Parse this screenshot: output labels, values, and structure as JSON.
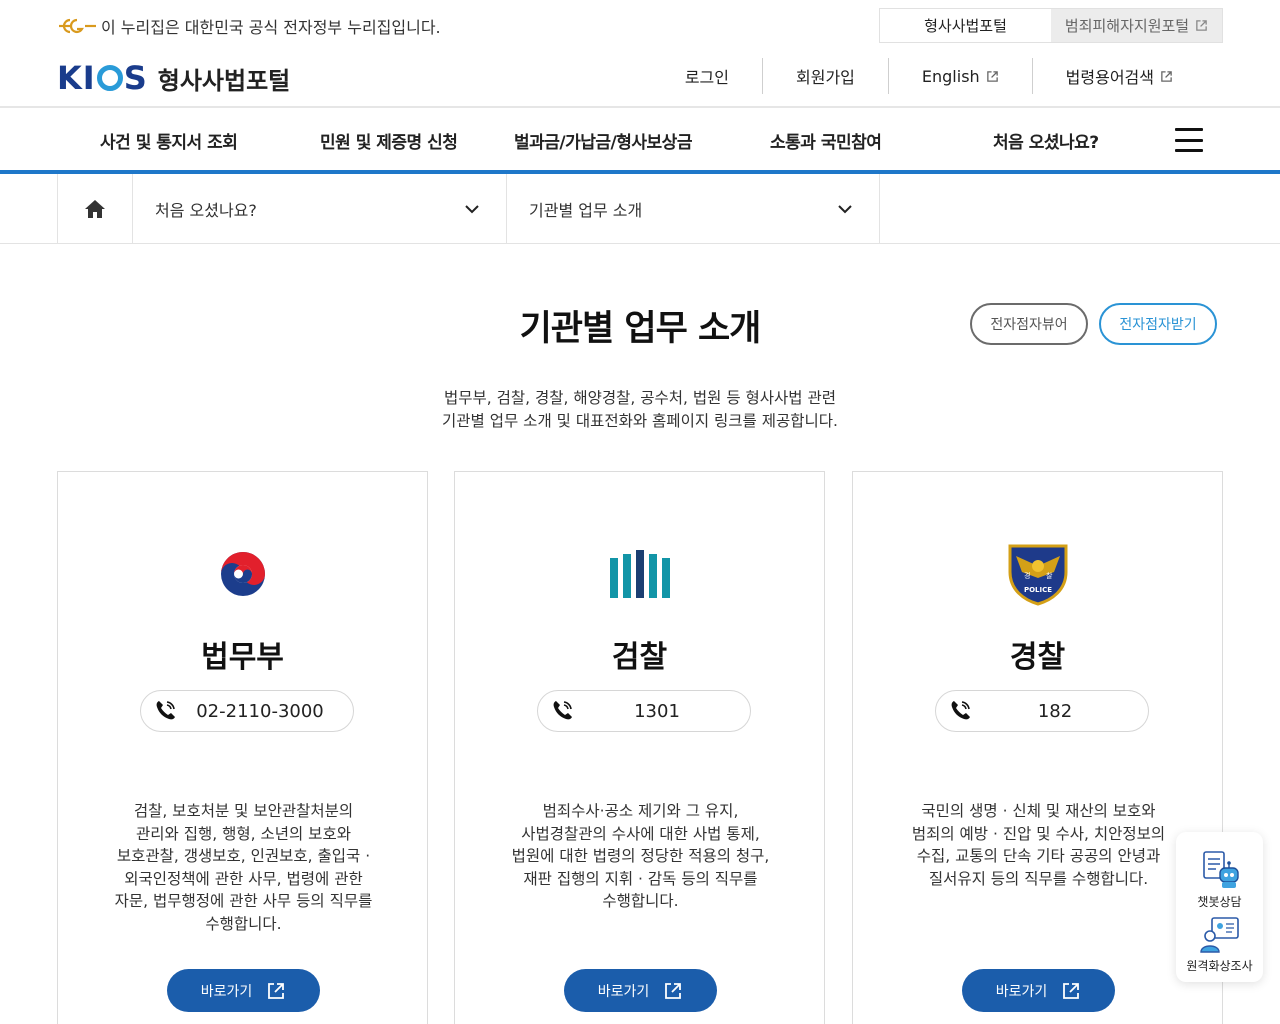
{
  "gov_banner": {
    "text": "이 누리집은 대한민국 공식 전자정부 누리집입니다.",
    "mark_icon": "egov-mark-icon"
  },
  "portal_switch": {
    "tabs": [
      {
        "label": "형사사법포털",
        "active": true
      },
      {
        "label": "범죄피해자지원포털",
        "active": false,
        "external": true
      }
    ]
  },
  "header": {
    "logo_text": "KICS",
    "site_name": "형사사법포털",
    "util_links": [
      {
        "label": "로그인",
        "external": false
      },
      {
        "label": "회원가입",
        "external": false
      },
      {
        "label": "English",
        "external": true
      },
      {
        "label": "법령용어검색",
        "external": true
      }
    ]
  },
  "gnb": {
    "menus": [
      "사건 및 통지서 조회",
      "민원 및 제증명 신청",
      "벌과금/가납금/형사보상금",
      "소통과 국민참여",
      "처음 오셨나요?"
    ],
    "menu_icon": "hamburger-menu-icon"
  },
  "breadcrumb": {
    "home_icon": "home-icon",
    "level1": "처음 오셨나요?",
    "level2": "기관별 업무 소개"
  },
  "page": {
    "title": "기관별 업무 소개",
    "braille_view": "전자점자뷰어",
    "braille_receive": "전자점자받기",
    "intro_line1": "법무부, 검찰, 경찰, 해양경찰, 공수처, 법원 등 형사사법 관련",
    "intro_line2": "기관별 업무 소개 및 대표전화와 홈페이지 링크를 제공합니다."
  },
  "cards": [
    {
      "name": "법무부",
      "phone": "02-2110-3000",
      "emblem_icon": "taegeuk-emblem-icon",
      "desc": [
        "검찰, 보호처분 및 보안관찰처분의",
        "관리와 집행, 행형, 소년의 보호와",
        "보호관찰, 갱생보호, 인권보호, 출입국 ·",
        "외국인정책에 관한 사무, 법령에 관한",
        "자문, 법무행정에 관한 사무 등의 직무를",
        "수행합니다."
      ],
      "button": "바로가기"
    },
    {
      "name": "검찰",
      "phone": "1301",
      "emblem_icon": "prosecution-emblem-icon",
      "desc": [
        "범죄수사·공소 제기와 그 유지,",
        "사법경찰관의 수사에 대한 사법 통제,",
        "법원에 대한 법령의 정당한 적용의 청구,",
        "재판 집행의 지휘 · 감독 등의 직무를",
        "수행합니다."
      ],
      "button": "바로가기"
    },
    {
      "name": "경찰",
      "phone": "182",
      "emblem_icon": "police-emblem-icon",
      "emblem_text": {
        "left": "경",
        "right": "찰",
        "bottom": "POLICE"
      },
      "desc": [
        "국민의 생명 · 신체 및 재산의 보호와",
        "범죄의 예방 · 진압 및 수사, 치안정보의",
        "수집, 교통의 단속 기타 공공의 안녕과",
        "질서유지 등의 직무를 수행합니다."
      ],
      "button": "바로가기"
    }
  ],
  "quick_menu": {
    "chatbot": "챗봇상담",
    "video": "원격화상조사"
  },
  "colors": {
    "brand_blue": "#1b5dab",
    "accent_blue": "#1e77c9",
    "light_blue": "#2a93d5"
  }
}
